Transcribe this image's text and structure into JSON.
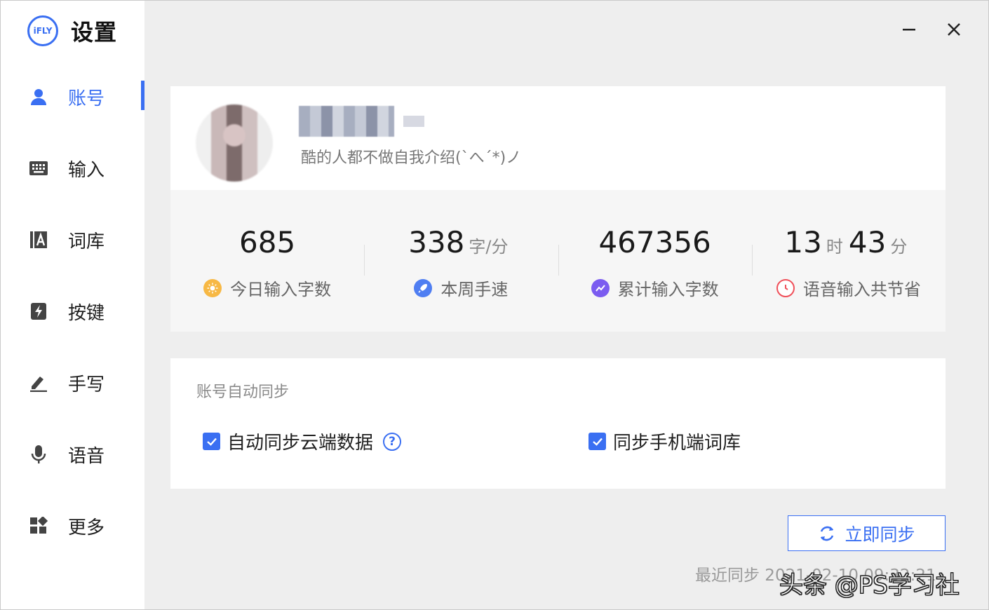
{
  "app": {
    "logo_text": "iFLY",
    "title": "设置",
    "accent": "#3a6ff2"
  },
  "sidebar": {
    "items": [
      {
        "label": "账号",
        "icon": "user-icon",
        "active": true
      },
      {
        "label": "输入",
        "icon": "keyboard-icon",
        "active": false
      },
      {
        "label": "词库",
        "icon": "dictionary-icon",
        "active": false
      },
      {
        "label": "按键",
        "icon": "key-bolt-icon",
        "active": false
      },
      {
        "label": "手写",
        "icon": "pen-icon",
        "active": false
      },
      {
        "label": "语音",
        "icon": "microphone-icon",
        "active": false
      },
      {
        "label": "更多",
        "icon": "apps-grid-icon",
        "active": false
      }
    ]
  },
  "profile": {
    "bio": "酷的人都不做自我介绍(`へ´*)ノ"
  },
  "stats": [
    {
      "value": "685",
      "unit": "",
      "value2": "",
      "unit2": "",
      "label": "今日输入字数",
      "icon": "sun-icon",
      "icon_color": "#f7b844"
    },
    {
      "value": "338",
      "unit": "字/分",
      "value2": "",
      "unit2": "",
      "label": "本周手速",
      "icon": "rocket-icon",
      "icon_color": "#4f7ef2"
    },
    {
      "value": "467356",
      "unit": "",
      "value2": "",
      "unit2": "",
      "label": "累计输入字数",
      "icon": "trend-icon",
      "icon_color": "#7b5cf0"
    },
    {
      "value": "13",
      "unit": "时",
      "value2": "43",
      "unit2": "分",
      "label": "语音输入共节省",
      "icon": "clock-icon",
      "icon_color": "#f0505a"
    }
  ],
  "sync": {
    "title": "账号自动同步",
    "options": [
      {
        "label": "自动同步云端数据",
        "checked": true,
        "has_help": true
      },
      {
        "label": "同步手机端词库",
        "checked": true,
        "has_help": false
      }
    ],
    "sync_now_label": "立即同步",
    "last_sync_label": "最近同步 2021-02-10 09:32:21"
  },
  "watermark": "头条 @PS学习社"
}
